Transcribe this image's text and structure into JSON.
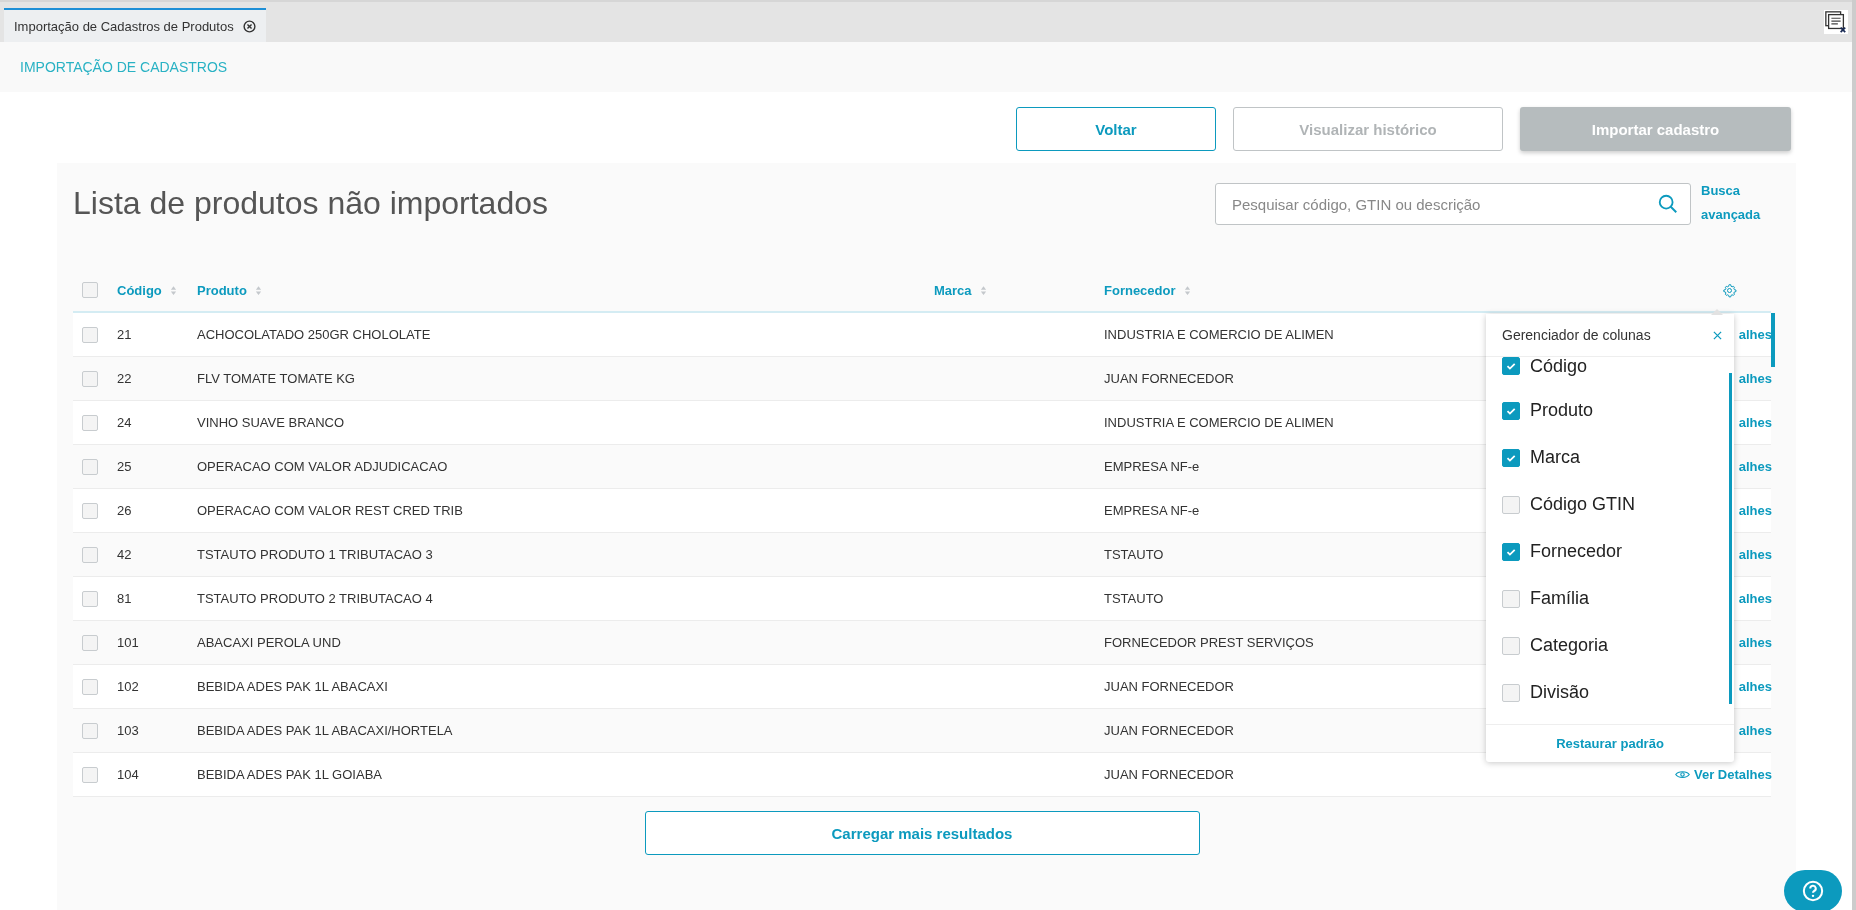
{
  "tabs": [
    {
      "label": "Importação de Cadastros de Produtos",
      "selected": true
    }
  ],
  "page_title": "IMPORTAÇÃO DE CADASTROS",
  "actions": [
    {
      "label": "Voltar",
      "kind": "outline",
      "disabled": false
    },
    {
      "label": "Visualizar histórico",
      "kind": "outline",
      "disabled": true
    },
    {
      "label": "Importar cadastro",
      "kind": "primary",
      "disabled": true
    }
  ],
  "list": {
    "title": "Lista de produtos não importados",
    "search": {
      "placeholder": "Pesquisar código, GTIN ou descrição"
    },
    "advanced_search": "Busca avançada",
    "select_all": {
      "checked": false
    },
    "columns": [
      {
        "label": "Código",
        "kind": "code"
      },
      {
        "label": "Produto",
        "kind": "product"
      },
      {
        "label": "Marca",
        "kind": "brand"
      },
      {
        "label": "Fornecedor",
        "kind": "supplier"
      }
    ],
    "rows": [
      {
        "checked": false,
        "code": "21",
        "product": "ACHOCOLATADO 250GR CHOLOLATE",
        "supplier": "INDUSTRIA E COMERCIO DE ALIMEN",
        "details": {
          "label": "alhes",
          "icon": false
        }
      },
      {
        "checked": false,
        "code": "22",
        "product": "FLV TOMATE TOMATE KG",
        "supplier": "JUAN FORNECEDOR",
        "details": {
          "label": "alhes",
          "icon": false
        }
      },
      {
        "checked": false,
        "code": "24",
        "product": "VINHO SUAVE BRANCO",
        "supplier": "INDUSTRIA E COMERCIO DE ALIMEN",
        "details": {
          "label": "alhes",
          "icon": false
        }
      },
      {
        "checked": false,
        "code": "25",
        "product": "OPERACAO COM VALOR ADJUDICACAO",
        "supplier": "EMPRESA NF-e",
        "details": {
          "label": "alhes",
          "icon": false
        }
      },
      {
        "checked": false,
        "code": "26",
        "product": "OPERACAO COM VALOR REST CRED TRIB",
        "supplier": "EMPRESA NF-e",
        "details": {
          "label": "alhes",
          "icon": false
        }
      },
      {
        "checked": false,
        "code": "42",
        "product": "TSTAUTO PRODUTO 1 TRIBUTACAO 3",
        "supplier": "TSTAUTO",
        "details": {
          "label": "alhes",
          "icon": false
        }
      },
      {
        "checked": false,
        "code": "81",
        "product": "TSTAUTO PRODUTO 2 TRIBUTACAO 4",
        "supplier": "TSTAUTO",
        "details": {
          "label": "alhes",
          "icon": false
        }
      },
      {
        "checked": false,
        "code": "101",
        "product": "ABACAXI PEROLA UND",
        "supplier": "FORNECEDOR PREST SERVIÇOS",
        "details": {
          "label": "alhes",
          "icon": false
        }
      },
      {
        "checked": false,
        "code": "102",
        "product": "BEBIDA ADES PAK 1L ABACAXI",
        "supplier": "JUAN FORNECEDOR",
        "details": {
          "label": "alhes",
          "icon": false
        }
      },
      {
        "checked": false,
        "code": "103",
        "product": "BEBIDA ADES PAK 1L ABACAXI/HORTELA",
        "supplier": "JUAN FORNECEDOR",
        "details": {
          "label": "alhes",
          "icon": false
        }
      },
      {
        "checked": false,
        "code": "104",
        "product": "BEBIDA ADES PAK 1L GOIABA",
        "supplier": "JUAN FORNECEDOR",
        "details": {
          "label": "Ver Detalhes",
          "icon": true
        }
      }
    ],
    "load_more": "Carregar mais resultados"
  },
  "column_manager": {
    "title": "Gerenciador de colunas",
    "items": [
      {
        "label": "Código",
        "checked": true
      },
      {
        "label": "Produto",
        "checked": true
      },
      {
        "label": "Marca",
        "checked": true
      },
      {
        "label": "Código GTIN",
        "checked": false
      },
      {
        "label": "Fornecedor",
        "checked": true
      },
      {
        "label": "Família",
        "checked": false
      },
      {
        "label": "Categoria",
        "checked": false
      },
      {
        "label": "Divisão",
        "checked": false
      }
    ],
    "restore": "Restaurar padrão"
  }
}
